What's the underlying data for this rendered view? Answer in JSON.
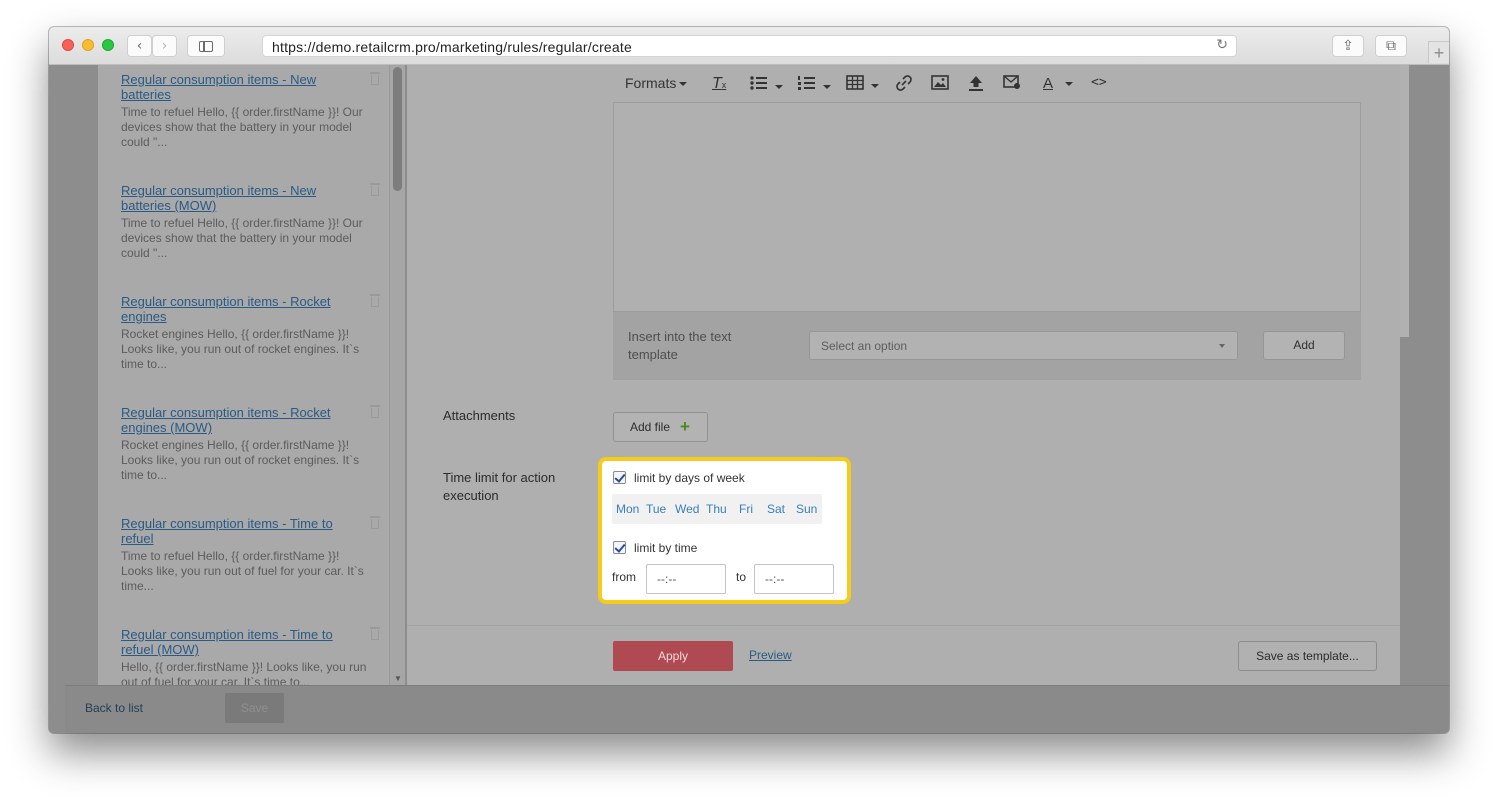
{
  "browser": {
    "url": "https://demo.retailcrm.pro/marketing/rules/regular/create",
    "back_glyph": "‹",
    "forward_glyph": "›",
    "reload_glyph": "↻",
    "share_glyph": "⇪",
    "tabs_glyph": "⧉",
    "newtab_glyph": "+"
  },
  "templates": [
    {
      "title": "Regular consumption items - New batteries",
      "desc": "Time to refuel Hello, {{ order.firstName }}! Our devices show that the battery in your model could \"..."
    },
    {
      "title": "Regular consumption items - New batteries (MOW)",
      "desc": "Time to refuel Hello, {{ order.firstName }}! Our devices show that the battery in your model could \"..."
    },
    {
      "title": "Regular consumption items - Rocket engines",
      "desc": "Rocket engines Hello, {{ order.firstName }}! Looks like, you run out of rocket engines. It`s time to..."
    },
    {
      "title": "Regular consumption items - Rocket engines (MOW)",
      "desc": "Rocket engines Hello, {{ order.firstName }}! Looks like, you run out of rocket engines. It`s time to..."
    },
    {
      "title": "Regular consumption items - Time to refuel",
      "desc": "Time to refuel Hello, {{ order.firstName }}! Looks like, you run out of fuel for your car. It`s time..."
    },
    {
      "title": "Regular consumption items - Time to refuel (MOW)",
      "desc": "Hello, {{ order.firstName }}! Looks like, you run out of fuel for your car. It`s time to..."
    }
  ],
  "editor": {
    "formats_label": "Formats",
    "font_color_glyph": "A",
    "code_glyph": "<>"
  },
  "insert": {
    "label": "Insert into the text template",
    "placeholder": "Select an option",
    "add_label": "Add"
  },
  "attachments": {
    "label": "Attachments",
    "add_file_label": "Add file",
    "plus_glyph": "+"
  },
  "time_limit": {
    "label": "Time limit for action execution",
    "by_days_label": "limit by days of week",
    "days": [
      "Mon",
      "Tue",
      "Wed",
      "Thu",
      "Fri",
      "Sat",
      "Sun"
    ],
    "by_time_label": "limit by time",
    "from_label": "from",
    "to_label": "to",
    "from_value": "--:--",
    "to_value": "--:--"
  },
  "actions": {
    "apply_label": "Apply",
    "preview_label": "Preview",
    "save_template_label": "Save as template..."
  },
  "footer": {
    "back_label": "Back to list",
    "save_label": "Save"
  },
  "colors": {
    "highlight": "#f5cc19",
    "apply": "#b04a52",
    "link": "#2a5a85"
  }
}
